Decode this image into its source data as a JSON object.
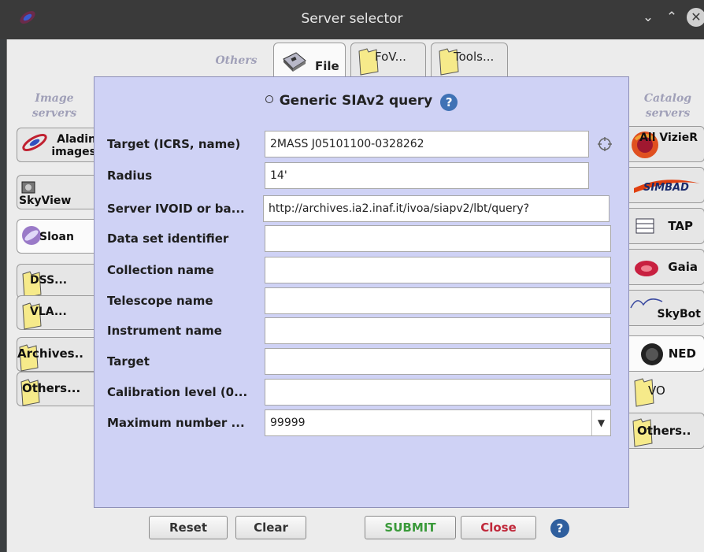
{
  "window": {
    "title": "Server selector"
  },
  "sections": {
    "others": "Others",
    "image_servers": "Image servers",
    "catalog_servers": "Catalog servers"
  },
  "top_tabs": [
    {
      "label": "File",
      "icon": "disk-icon",
      "active": true
    },
    {
      "label": "FoV...",
      "icon": "folder-icon"
    },
    {
      "label": "Tools...",
      "icon": "folder-icon"
    }
  ],
  "left_tabs": [
    {
      "label": "Aladin images",
      "icon": "aladin-icon"
    },
    {
      "label": "SkyView",
      "icon": "skyview-icon"
    },
    {
      "label": "Sloan",
      "icon": "sloan-icon",
      "active": true
    },
    {
      "label": "DSS...",
      "icon": "folder-icon"
    },
    {
      "label": "VLA...",
      "icon": "folder-icon"
    },
    {
      "label": "Archives..",
      "icon": "folder-icon"
    },
    {
      "label": "Others...",
      "icon": "folder-icon"
    }
  ],
  "right_tabs": [
    {
      "label": "All VizieR",
      "icon": "vizier-icon"
    },
    {
      "label": "SIMBAD",
      "icon": "simbad-logo"
    },
    {
      "label": "TAP",
      "icon": "tap-icon"
    },
    {
      "label": "Gaia",
      "icon": "gaia-icon"
    },
    {
      "label": "SkyBot",
      "icon": "skybot-icon"
    },
    {
      "label": "NED",
      "icon": "ned-icon"
    },
    {
      "label": "VO",
      "icon": "folder-icon"
    },
    {
      "label": "Others..",
      "icon": "folder-icon"
    }
  ],
  "query": {
    "radio_label": "Generic SIAv2 query",
    "fields": [
      {
        "label": "Target (ICRS, name)",
        "value": "2MASS J05101100-0328262"
      },
      {
        "label": "Radius",
        "value": "14'"
      },
      {
        "label": "Server IVOID or ba...",
        "value": "http://archives.ia2.inaf.it/ivoa/siapv2/lbt/query?"
      },
      {
        "label": "Data set identifier",
        "value": ""
      },
      {
        "label": "Collection name",
        "value": ""
      },
      {
        "label": "Telescope name",
        "value": ""
      },
      {
        "label": "Instrument name",
        "value": ""
      },
      {
        "label": "Target",
        "value": ""
      },
      {
        "label": "Calibration level (0...",
        "value": ""
      },
      {
        "label": "Maximum number ...",
        "value": "99999"
      }
    ]
  },
  "buttons": {
    "reset": "Reset",
    "clear": "Clear",
    "submit": "SUBMIT",
    "close": "Close"
  },
  "colors": {
    "panel": "#cfd2f5",
    "submit": "#3a9a3a",
    "close": "#c0283a",
    "help": "#3f72b5"
  }
}
